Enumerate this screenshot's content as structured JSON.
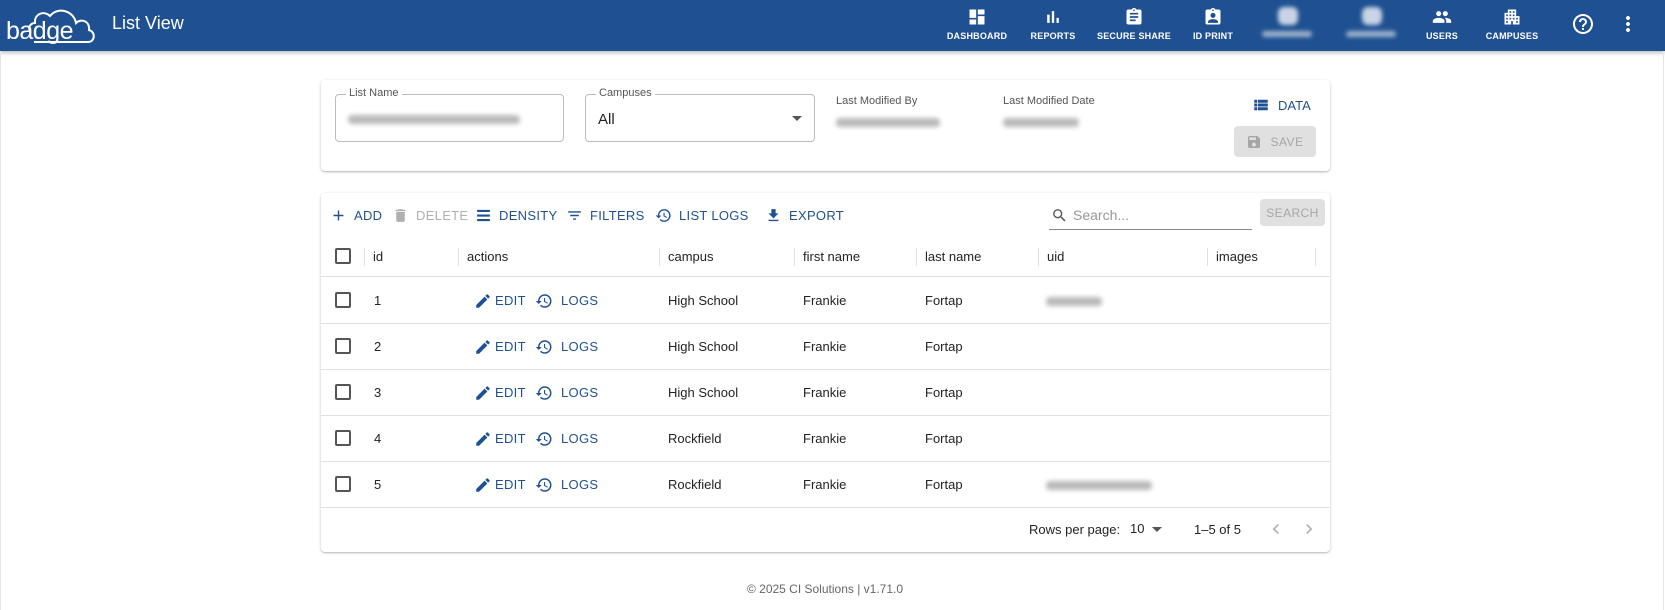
{
  "app": {
    "logo_text": "badge",
    "title": "List View"
  },
  "nav": {
    "dashboard": "DASHBOARD",
    "reports": "REPORTS",
    "secure_share": "SECURE SHARE",
    "id_print": "ID PRINT",
    "users": "USERS",
    "campuses": "CAMPUSES"
  },
  "form": {
    "list_name_label": "List Name",
    "campuses_label": "Campuses",
    "campuses_value": "All",
    "last_modified_by_label": "Last Modified By",
    "last_modified_date_label": "Last Modified Date",
    "data_button": "DATA",
    "save_button": "SAVE"
  },
  "toolbar": {
    "add": "ADD",
    "delete": "DELETE",
    "density": "DENSITY",
    "filters": "FILTERS",
    "list_logs": "LIST LOGS",
    "export": "EXPORT",
    "search_placeholder": "Search...",
    "search_button": "SEARCH"
  },
  "grid": {
    "columns": [
      "id",
      "actions",
      "campus",
      "first name",
      "last name",
      "uid",
      "images"
    ],
    "edit_label": "EDIT",
    "logs_label": "LOGS",
    "rows": [
      {
        "id": "1",
        "campus": "High School",
        "first_name": "Frankie",
        "last_name": "Fortap"
      },
      {
        "id": "2",
        "campus": "High School",
        "first_name": "Frankie",
        "last_name": "Fortap"
      },
      {
        "id": "3",
        "campus": "High School",
        "first_name": "Frankie",
        "last_name": "Fortap"
      },
      {
        "id": "4",
        "campus": "Rockfield",
        "first_name": "Frankie",
        "last_name": "Fortap"
      },
      {
        "id": "5",
        "campus": "Rockfield",
        "first_name": "Frankie",
        "last_name": "Fortap"
      }
    ]
  },
  "pagination": {
    "rows_per_page_label": "Rows per page:",
    "rows_per_page_value": "10",
    "range_text": "1–5 of 5"
  },
  "footer": {
    "copyright": "© 2025 CI Solutions | v1.71.0"
  },
  "colors": {
    "primary": "#1f5192",
    "disabled": "#e0e0e0"
  }
}
